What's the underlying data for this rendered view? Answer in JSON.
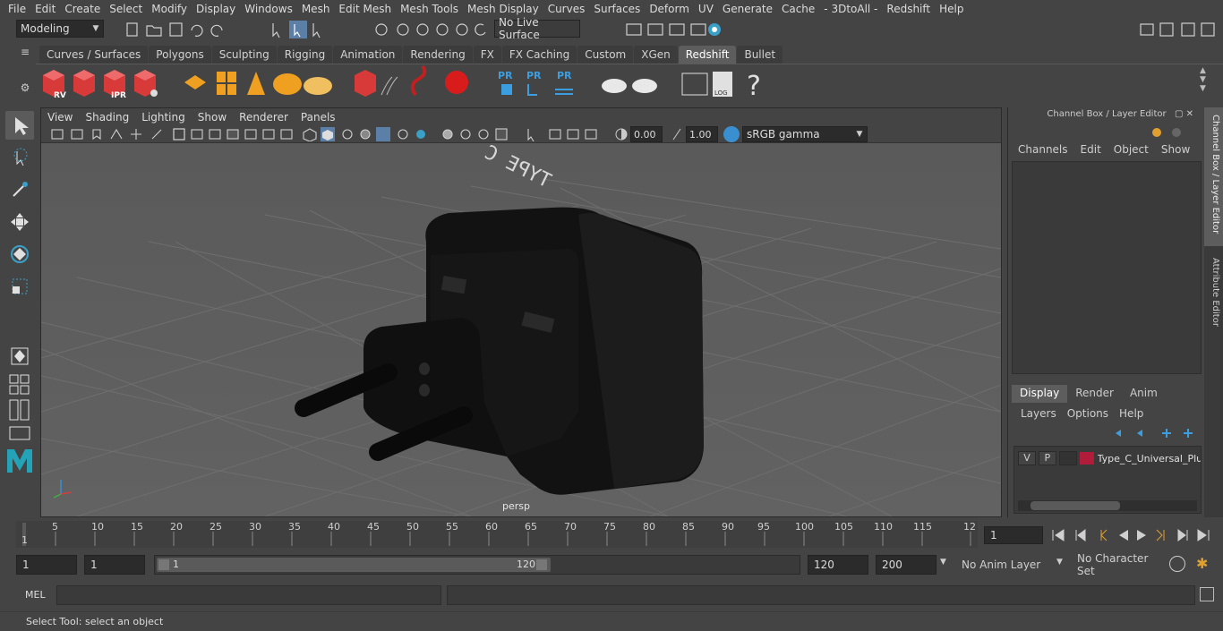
{
  "menubar": {
    "items": [
      "File",
      "Edit",
      "Create",
      "Select",
      "Modify",
      "Display",
      "Windows",
      "Mesh",
      "Edit Mesh",
      "Mesh Tools",
      "Mesh Display",
      "Curves",
      "Surfaces",
      "Deform",
      "UV",
      "Generate",
      "Cache",
      "- 3DtoAll -",
      "Redshift",
      "Help"
    ]
  },
  "statusline": {
    "mode": "Modeling",
    "live_surface": "No Live Surface"
  },
  "shelf": {
    "tabs": [
      "Curves / Surfaces",
      "Polygons",
      "Sculpting",
      "Rigging",
      "Animation",
      "Rendering",
      "FX",
      "FX Caching",
      "Custom",
      "XGen",
      "Redshift",
      "Bullet"
    ],
    "active_tab": "Redshift",
    "rv_label": "RV",
    "ipr_label": "IPR",
    "pr_label": "PR",
    "log_label": "LOG",
    "help_glyph": "?"
  },
  "viewport": {
    "menu": [
      "View",
      "Shading",
      "Lighting",
      "Show",
      "Renderer",
      "Panels"
    ],
    "exposure": "0.00",
    "gamma": "1.00",
    "colorspace": "sRGB gamma",
    "camera_label": "persp",
    "model_text": "TYPE C"
  },
  "channelbox": {
    "title": "Channel Box / Layer Editor",
    "menu": [
      "Channels",
      "Edit",
      "Object",
      "Show"
    ],
    "layer_tabs": [
      "Display",
      "Render",
      "Anim"
    ],
    "active_layer_tab": "Display",
    "layer_menu": [
      "Layers",
      "Options",
      "Help"
    ],
    "layer": {
      "v": "V",
      "p": "P",
      "name": "Type_C_Universal_Plug",
      "color": "#b01c3a"
    }
  },
  "side_tabs": [
    "Channel Box / Layer Editor",
    "Attribute Editor"
  ],
  "timeslider": {
    "ticks": [
      "5",
      "10",
      "15",
      "20",
      "25",
      "30",
      "35",
      "40",
      "45",
      "50",
      "55",
      "60",
      "65",
      "70",
      "75",
      "80",
      "85",
      "90",
      "95",
      "100",
      "105",
      "110",
      "115",
      "12"
    ],
    "start_marker": "1",
    "current_frame": "1"
  },
  "range": {
    "start": "1",
    "start2": "1",
    "slider_start": "1",
    "slider_end": "120",
    "end": "120",
    "end2": "200",
    "anim_layer": "No Anim Layer",
    "character_set": "No Character Set"
  },
  "cmdline": {
    "label": "MEL"
  },
  "helpline": {
    "text": "Select Tool: select an object"
  },
  "colors": {
    "bg": "#444444",
    "viewport_bg": "#5a5a5a",
    "accent": "#5d5d5d",
    "redshift_red": "#d83a3a",
    "orange": "#f0a020"
  }
}
